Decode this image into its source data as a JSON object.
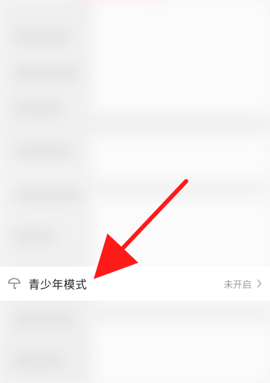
{
  "row": {
    "label": "青少年模式",
    "status": "未开启"
  },
  "colors": {
    "arrow": "#ff1a1a",
    "text_primary": "#222222",
    "text_secondary": "#9a9a9a"
  },
  "icons": {
    "left": "umbrella-icon",
    "chevron": "chevron-right-icon"
  }
}
